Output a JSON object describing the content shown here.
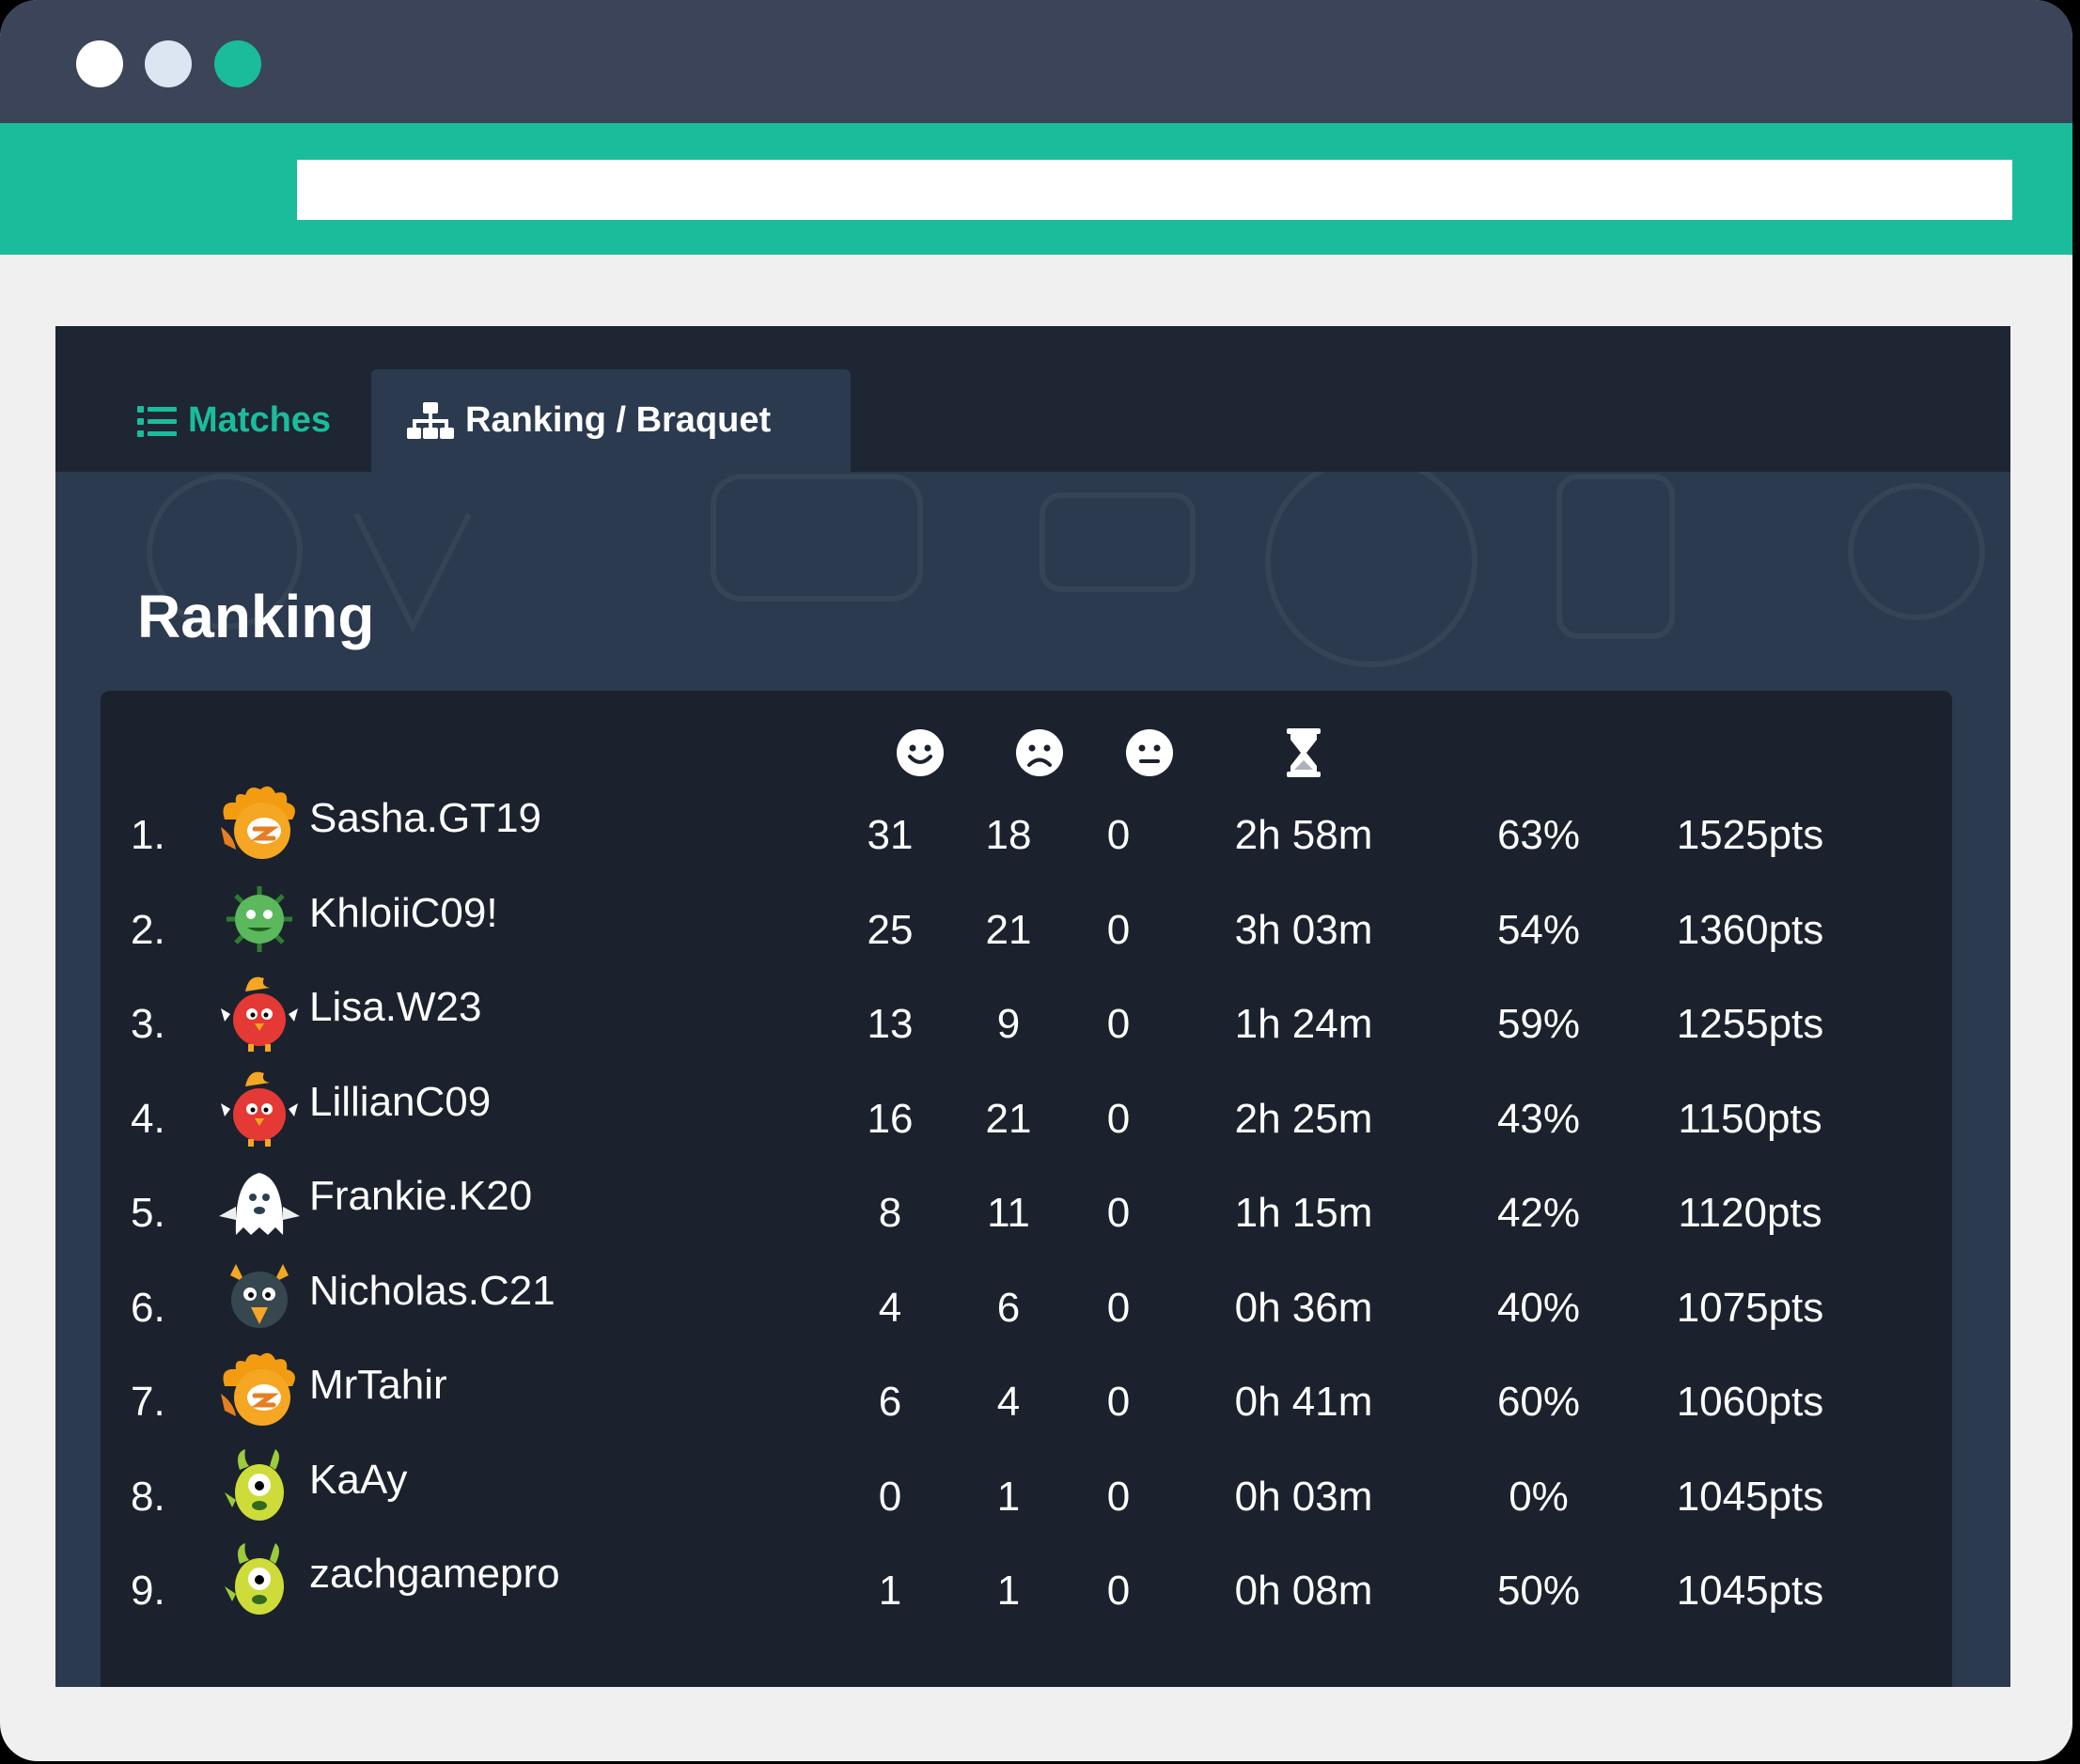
{
  "colors": {
    "titlebar": "#3b4459",
    "accent": "#1abc9c",
    "app_bg": "#2b3a4e",
    "tabbar_bg": "#1d2632",
    "panel_bg": "#1b222d",
    "text": "#ffffff",
    "tab_active_text": "#ffffff",
    "tab_inactive_text": "#1abc9c"
  },
  "window": {
    "traffic_lights": [
      "#ffffff",
      "#dce6f2",
      "#1abc9c"
    ]
  },
  "tabs": {
    "matches": {
      "label": "Matches",
      "icon": "list-icon"
    },
    "ranking": {
      "label": "Ranking / Braquet",
      "icon": "sitemap-icon"
    }
  },
  "section_title": "Ranking",
  "table": {
    "header_icons": {
      "wins": "smile-icon",
      "losses": "frown-icon",
      "draws": "neutral-face-icon",
      "time": "hourglass-icon"
    },
    "rows": [
      {
        "rank": "1.",
        "avatar": "orange-monster-avatar",
        "name": "Sasha.GT19",
        "wins": "31",
        "losses": "18",
        "draws": "0",
        "time": "2h 58m",
        "pct": "63%",
        "pts": "1525pts"
      },
      {
        "rank": "2.",
        "avatar": "green-virus-avatar",
        "name": "KhloiiC09!",
        "wins": "25",
        "losses": "21",
        "draws": "0",
        "time": "3h 03m",
        "pct": "54%",
        "pts": "1360pts"
      },
      {
        "rank": "3.",
        "avatar": "red-bird-avatar",
        "name": "Lisa.W23",
        "wins": "13",
        "losses": "9",
        "draws": "0",
        "time": "1h 24m",
        "pct": "59%",
        "pts": "1255pts"
      },
      {
        "rank": "4.",
        "avatar": "red-bird-avatar",
        "name": "LillianC09",
        "wins": "16",
        "losses": "21",
        "draws": "0",
        "time": "2h 25m",
        "pct": "43%",
        "pts": "1150pts"
      },
      {
        "rank": "5.",
        "avatar": "ghost-avatar",
        "name": "Frankie.K20",
        "wins": "8",
        "losses": "11",
        "draws": "0",
        "time": "1h 15m",
        "pct": "42%",
        "pts": "1120pts"
      },
      {
        "rank": "6.",
        "avatar": "dark-bird-avatar",
        "name": "Nicholas.C21",
        "wins": "4",
        "losses": "6",
        "draws": "0",
        "time": "0h 36m",
        "pct": "40%",
        "pts": "1075pts"
      },
      {
        "rank": "7.",
        "avatar": "orange-monster-avatar",
        "name": "MrTahir",
        "wins": "6",
        "losses": "4",
        "draws": "0",
        "time": "0h 41m",
        "pct": "60%",
        "pts": "1060pts"
      },
      {
        "rank": "8.",
        "avatar": "yellow-cyclops-avatar",
        "name": "KaAy",
        "wins": "0",
        "losses": "1",
        "draws": "0",
        "time": "0h 03m",
        "pct": "0%",
        "pts": "1045pts"
      },
      {
        "rank": "9.",
        "avatar": "yellow-cyclops-avatar",
        "name": "zachgamepro",
        "wins": "1",
        "losses": "1",
        "draws": "0",
        "time": "0h 08m",
        "pct": "50%",
        "pts": "1045pts"
      }
    ]
  }
}
